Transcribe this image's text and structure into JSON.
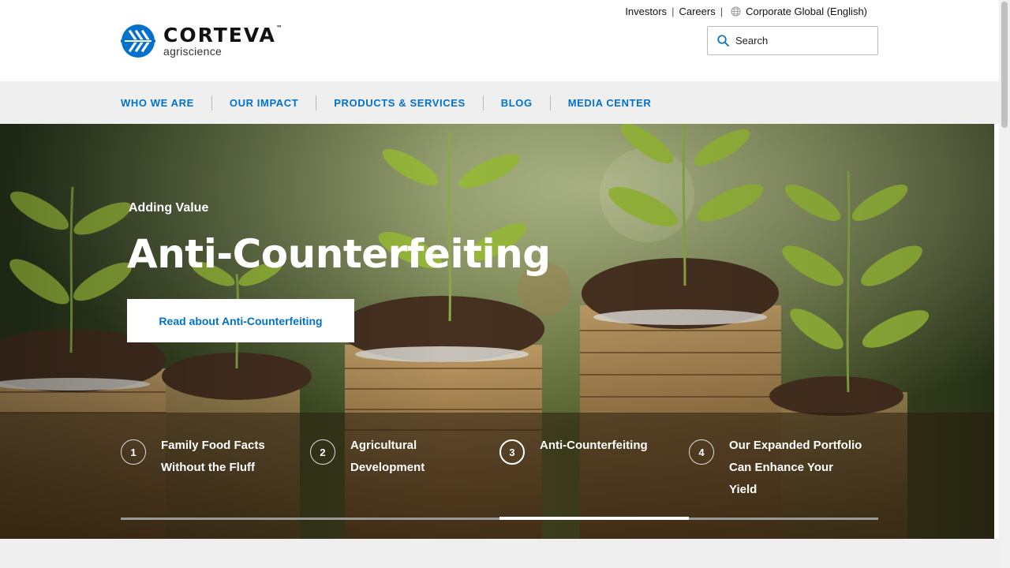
{
  "brand": {
    "name": "CORTEVA",
    "tm": "™",
    "sub": "agriscience",
    "color": "#0072ce"
  },
  "utility": {
    "investors": "Investors",
    "careers": "Careers",
    "region": "Corporate Global (English)",
    "separator": "|",
    "icon": "globe-icon"
  },
  "search": {
    "placeholder": "Search",
    "value": "",
    "icon": "search-icon"
  },
  "nav": [
    {
      "label": "WHO WE ARE"
    },
    {
      "label": "OUR IMPACT"
    },
    {
      "label": "PRODUCTS & SERVICES"
    },
    {
      "label": "BLOG"
    },
    {
      "label": "MEDIA CENTER"
    }
  ],
  "hero": {
    "eyebrow": "Adding Value",
    "title": "Anti-Counterfeiting",
    "cta": "Read about Anti-Counterfeiting"
  },
  "slides": [
    {
      "num": "1",
      "label": "Family Food Facts Without the Fluff"
    },
    {
      "num": "2",
      "label": "Agricultural Development"
    },
    {
      "num": "3",
      "label": "Anti-Counterfeiting",
      "active": true
    },
    {
      "num": "4",
      "label": "Our Expanded Portfolio Can Enhance Your Yield"
    }
  ],
  "carousel": {
    "active_index": 3,
    "total": 4
  }
}
